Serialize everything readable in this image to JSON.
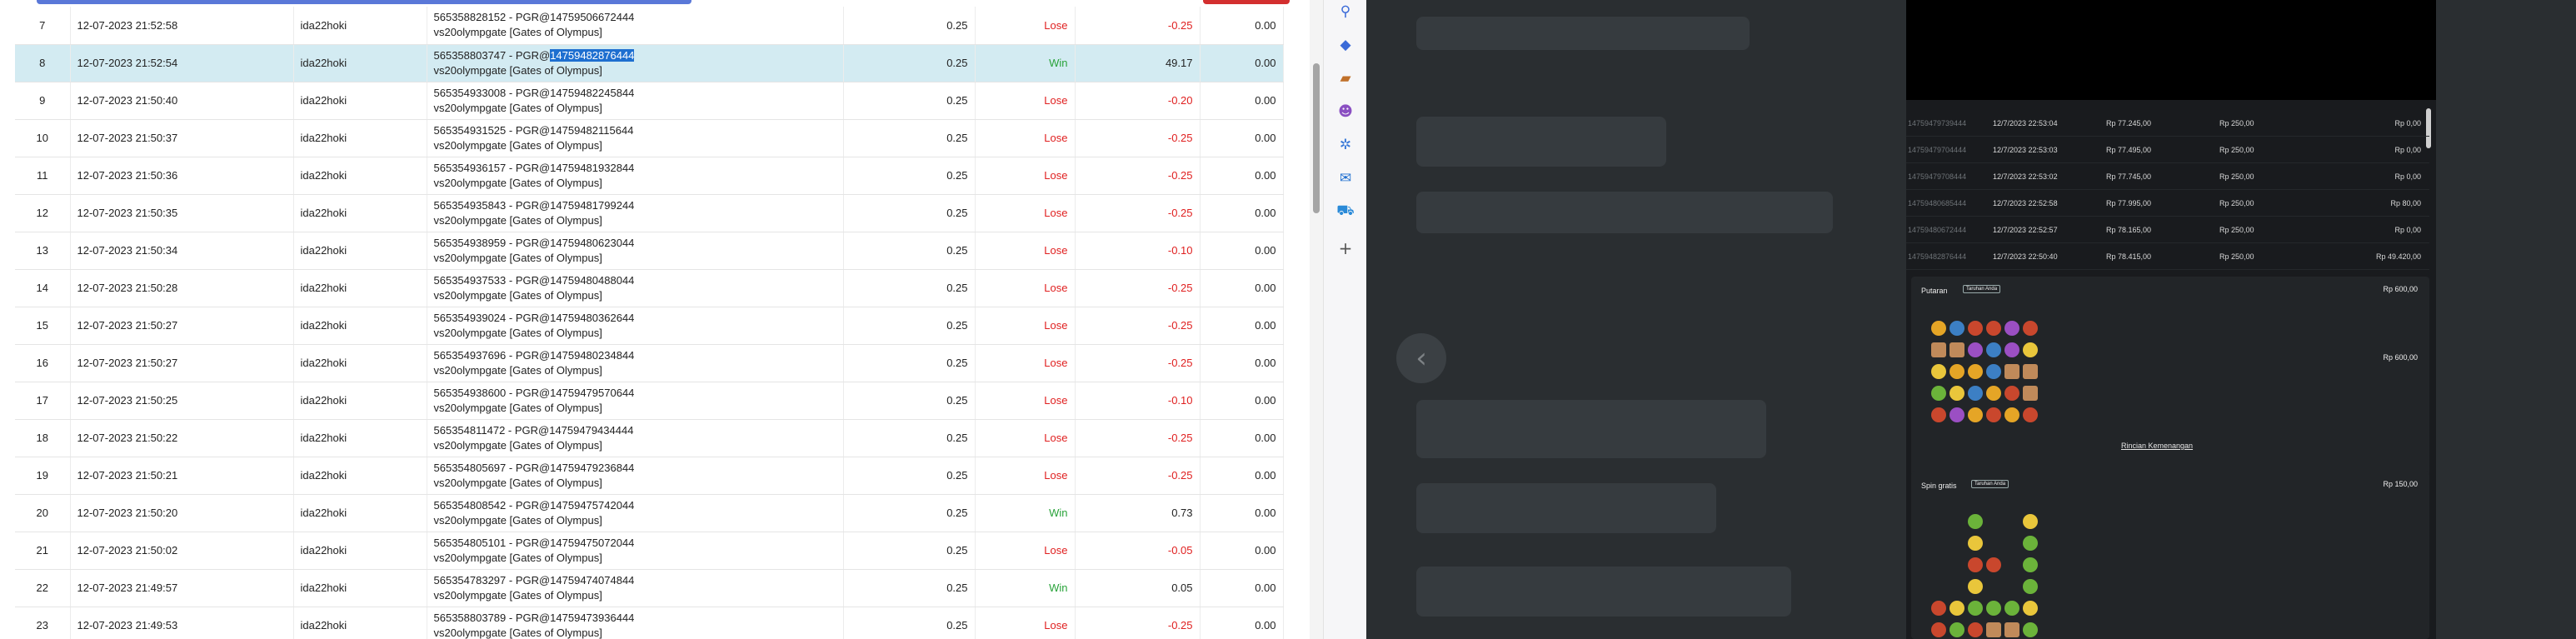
{
  "table": {
    "rows": [
      {
        "no": "7",
        "time": "12-07-2023 21:52:58",
        "user": "ida22hoki",
        "desc1": "565358828152 - PGR@14759506672444",
        "desc2": "vs20olympgate [Gates of Olympus]",
        "bet": "0.25",
        "result": "Lose",
        "win": "-0.25",
        "balance": "0.00"
      },
      {
        "no": "8",
        "time": "12-07-2023 21:52:54",
        "user": "ida22hoki",
        "desc1_prefix": "565358803747 - PGR@",
        "desc1_highlight": "14759482876444",
        "desc2": "vs20olympgate [Gates of Olympus]",
        "bet": "0.25",
        "result": "Win",
        "win": "49.17",
        "balance": "0.00"
      },
      {
        "no": "9",
        "time": "12-07-2023 21:50:40",
        "user": "ida22hoki",
        "desc1": "565354933008 - PGR@14759482245844",
        "desc2": "vs20olympgate [Gates of Olympus]",
        "bet": "0.25",
        "result": "Lose",
        "win": "-0.20",
        "balance": "0.00"
      },
      {
        "no": "10",
        "time": "12-07-2023 21:50:37",
        "user": "ida22hoki",
        "desc1": "565354931525 - PGR@14759482115644",
        "desc2": "vs20olympgate [Gates of Olympus]",
        "bet": "0.25",
        "result": "Lose",
        "win": "-0.25",
        "balance": "0.00"
      },
      {
        "no": "11",
        "time": "12-07-2023 21:50:36",
        "user": "ida22hoki",
        "desc1": "565354936157 - PGR@14759481932844",
        "desc2": "vs20olympgate [Gates of Olympus]",
        "bet": "0.25",
        "result": "Lose",
        "win": "-0.25",
        "balance": "0.00"
      },
      {
        "no": "12",
        "time": "12-07-2023 21:50:35",
        "user": "ida22hoki",
        "desc1": "565354935843 - PGR@14759481799244",
        "desc2": "vs20olympgate [Gates of Olympus]",
        "bet": "0.25",
        "result": "Lose",
        "win": "-0.25",
        "balance": "0.00"
      },
      {
        "no": "13",
        "time": "12-07-2023 21:50:34",
        "user": "ida22hoki",
        "desc1": "565354938959 - PGR@14759480623044",
        "desc2": "vs20olympgate [Gates of Olympus]",
        "bet": "0.25",
        "result": "Lose",
        "win": "-0.10",
        "balance": "0.00"
      },
      {
        "no": "14",
        "time": "12-07-2023 21:50:28",
        "user": "ida22hoki",
        "desc1": "565354937533 - PGR@14759480488044",
        "desc2": "vs20olympgate [Gates of Olympus]",
        "bet": "0.25",
        "result": "Lose",
        "win": "-0.25",
        "balance": "0.00"
      },
      {
        "no": "15",
        "time": "12-07-2023 21:50:27",
        "user": "ida22hoki",
        "desc1": "565354939024 - PGR@14759480362644",
        "desc2": "vs20olympgate [Gates of Olympus]",
        "bet": "0.25",
        "result": "Lose",
        "win": "-0.25",
        "balance": "0.00"
      },
      {
        "no": "16",
        "time": "12-07-2023 21:50:27",
        "user": "ida22hoki",
        "desc1": "565354937696 - PGR@14759480234844",
        "desc2": "vs20olympgate [Gates of Olympus]",
        "bet": "0.25",
        "result": "Lose",
        "win": "-0.25",
        "balance": "0.00"
      },
      {
        "no": "17",
        "time": "12-07-2023 21:50:25",
        "user": "ida22hoki",
        "desc1": "565354938600 - PGR@14759479570644",
        "desc2": "vs20olympgate [Gates of Olympus]",
        "bet": "0.25",
        "result": "Lose",
        "win": "-0.10",
        "balance": "0.00"
      },
      {
        "no": "18",
        "time": "12-07-2023 21:50:22",
        "user": "ida22hoki",
        "desc1": "565354811472 - PGR@14759479434444",
        "desc2": "vs20olympgate [Gates of Olympus]",
        "bet": "0.25",
        "result": "Lose",
        "win": "-0.25",
        "balance": "0.00"
      },
      {
        "no": "19",
        "time": "12-07-2023 21:50:21",
        "user": "ida22hoki",
        "desc1": "565354805697 - PGR@14759479236844",
        "desc2": "vs20olympgate [Gates of Olympus]",
        "bet": "0.25",
        "result": "Lose",
        "win": "-0.25",
        "balance": "0.00"
      },
      {
        "no": "20",
        "time": "12-07-2023 21:50:20",
        "user": "ida22hoki",
        "desc1": "565354808542 - PGR@14759475742044",
        "desc2": "vs20olympgate [Gates of Olympus]",
        "bet": "0.25",
        "result": "Win",
        "win": "0.73",
        "balance": "0.00"
      },
      {
        "no": "21",
        "time": "12-07-2023 21:50:02",
        "user": "ida22hoki",
        "desc1": "565354805101 - PGR@14759475072044",
        "desc2": "vs20olympgate [Gates of Olympus]",
        "bet": "0.25",
        "result": "Lose",
        "win": "-0.05",
        "balance": "0.00"
      },
      {
        "no": "22",
        "time": "12-07-2023 21:49:57",
        "user": "ida22hoki",
        "desc1": "565354783297 - PGR@14759474074844",
        "desc2": "vs20olympgate [Gates of Olympus]",
        "bet": "0.25",
        "result": "Win",
        "win": "0.05",
        "balance": "0.00"
      },
      {
        "no": "23",
        "time": "12-07-2023 21:49:53",
        "user": "ida22hoki",
        "desc1": "565358803789 - PGR@14759473936444",
        "desc2": "vs20olympgate [Gates of Olympus]",
        "bet": "0.25",
        "result": "Lose",
        "win": "-0.25",
        "balance": "0.00"
      }
    ]
  },
  "sidebar": {
    "icons": [
      "search-icon",
      "tag-icon",
      "briefcase-icon",
      "people-icon",
      "copilot-icon",
      "outlook-icon",
      "shopping-icon",
      "add-icon"
    ]
  },
  "viewer": {
    "history_rows": [
      {
        "id": "14759479739444",
        "date": "12/7/2023 22:53:04",
        "balance": "Rp 77.245,00",
        "bet": "Rp 250,00",
        "win": "Rp 0,00"
      },
      {
        "id": "14759479704444",
        "date": "12/7/2023 22:53:03",
        "balance": "Rp 77.495,00",
        "bet": "Rp 250,00",
        "win": "Rp 0,00"
      },
      {
        "id": "14759479708444",
        "date": "12/7/2023 22:53:02",
        "balance": "Rp 77.745,00",
        "bet": "Rp 250,00",
        "win": "Rp 0,00"
      },
      {
        "id": "14759480685444",
        "date": "12/7/2023 22:52:58",
        "balance": "Rp 77.995,00",
        "bet": "Rp 250,00",
        "win": "Rp 80,00"
      },
      {
        "id": "14759480672444",
        "date": "12/7/2023 22:52:57",
        "balance": "Rp 78.165,00",
        "bet": "Rp 250,00",
        "win": "Rp 0,00"
      },
      {
        "id": "14759482876444",
        "date": "12/7/2023 22:50:40",
        "balance": "Rp 78.415,00",
        "bet": "Rp 250,00",
        "win": "Rp 49.420,00"
      }
    ],
    "putaran": {
      "title": "Putaran",
      "tag": "Taruhan Anda",
      "right1": "Rp 600,00",
      "right2": "Rp 600,00",
      "link": "Rincian Kemenangan"
    },
    "spin_gratis": {
      "title": "Spin gratis",
      "tag": "Taruhan Anda",
      "right1": "Rp 150,00"
    },
    "prev_label": "‹"
  }
}
